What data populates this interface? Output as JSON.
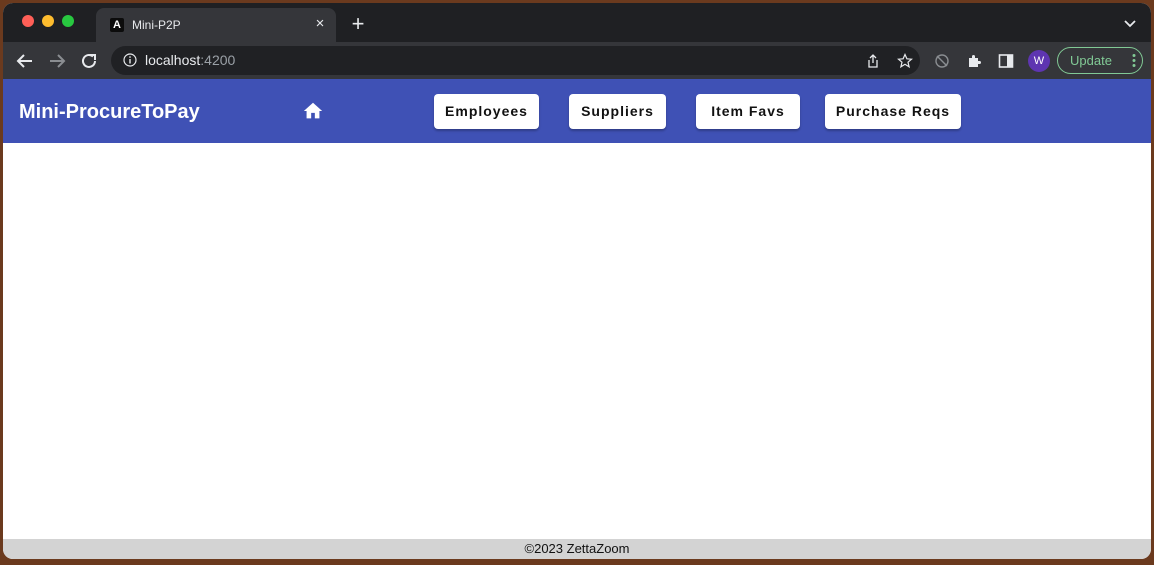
{
  "browser": {
    "tab": {
      "favicon": "angular-icon",
      "favicon_letter": "A",
      "title": "Mini-P2P"
    },
    "address": {
      "host": "localhost",
      "port": ":4200"
    },
    "profile_initial": "W",
    "update_label": "Update"
  },
  "app": {
    "brand": "Mini-ProcureToPay",
    "home_icon": "home-icon",
    "nav": [
      {
        "label": "Employees"
      },
      {
        "label": "Suppliers"
      },
      {
        "label": "Item Favs"
      },
      {
        "label": "Purchase Reqs"
      }
    ],
    "footer": "©2023 ZettaZoom"
  },
  "colors": {
    "navbar": "#3f51b5",
    "footer": "#d3d3d3",
    "update_accent": "#81c995",
    "avatar": "#5e35b1"
  }
}
